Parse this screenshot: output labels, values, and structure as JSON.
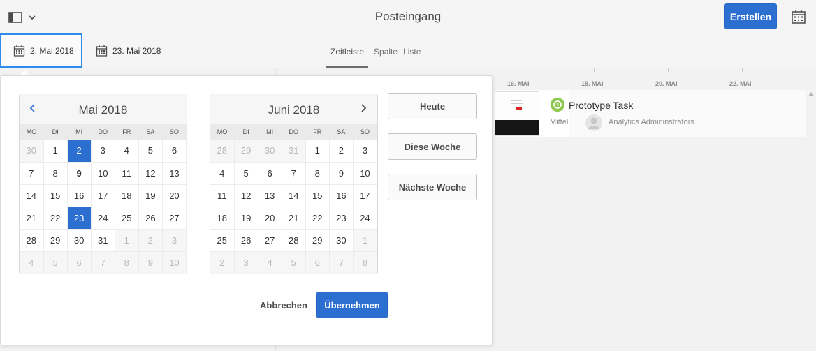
{
  "header": {
    "title": "Posteingang",
    "create_label": "Erstellen",
    "rail_icon": "rail-toggle-icon",
    "calendar_icon": "calendar-icon"
  },
  "toolbar": {
    "start_date": "2. Mai 2018",
    "end_date": "23. Mai 2018",
    "tabs": [
      {
        "label": "Zeitleiste",
        "active": true
      },
      {
        "label": "Spalte",
        "active": false
      },
      {
        "label": "Liste",
        "active": false
      }
    ]
  },
  "timeline": {
    "axis_labels": [
      "16. MAI",
      "18. MAI",
      "20. MAI",
      "22. MAI"
    ],
    "task": {
      "title": "Prototype Task",
      "priority": "Mittel",
      "assignee": "Analytics Admininstrators",
      "status_color": "#8fc851"
    }
  },
  "popover": {
    "weekdays": [
      "MO",
      "DI",
      "MI",
      "DO",
      "FR",
      "SA",
      "SO"
    ],
    "calendars": [
      {
        "title": "Mai 2018",
        "nav": "prev",
        "weeks": [
          [
            [
              "30",
              "out"
            ],
            [
              "1",
              ""
            ],
            [
              "2",
              "sel"
            ],
            [
              "3",
              ""
            ],
            [
              "4",
              ""
            ],
            [
              "5",
              ""
            ],
            [
              "6",
              ""
            ]
          ],
          [
            [
              "7",
              ""
            ],
            [
              "8",
              ""
            ],
            [
              "9",
              "today"
            ],
            [
              "10",
              ""
            ],
            [
              "11",
              ""
            ],
            [
              "12",
              ""
            ],
            [
              "13",
              ""
            ]
          ],
          [
            [
              "14",
              ""
            ],
            [
              "15",
              ""
            ],
            [
              "16",
              ""
            ],
            [
              "17",
              ""
            ],
            [
              "18",
              ""
            ],
            [
              "19",
              ""
            ],
            [
              "20",
              ""
            ]
          ],
          [
            [
              "21",
              ""
            ],
            [
              "22",
              ""
            ],
            [
              "23",
              "sel"
            ],
            [
              "24",
              ""
            ],
            [
              "25",
              ""
            ],
            [
              "26",
              ""
            ],
            [
              "27",
              ""
            ]
          ],
          [
            [
              "28",
              ""
            ],
            [
              "29",
              ""
            ],
            [
              "30",
              ""
            ],
            [
              "31",
              ""
            ],
            [
              "1",
              "out"
            ],
            [
              "2",
              "out"
            ],
            [
              "3",
              "out"
            ]
          ],
          [
            [
              "4",
              "out"
            ],
            [
              "5",
              "out"
            ],
            [
              "6",
              "out"
            ],
            [
              "7",
              "out"
            ],
            [
              "8",
              "out"
            ],
            [
              "9",
              "out"
            ],
            [
              "10",
              "out"
            ]
          ]
        ]
      },
      {
        "title": "Juni 2018",
        "nav": "next",
        "weeks": [
          [
            [
              "28",
              "out"
            ],
            [
              "29",
              "out"
            ],
            [
              "30",
              "out"
            ],
            [
              "31",
              "out"
            ],
            [
              "1",
              ""
            ],
            [
              "2",
              ""
            ],
            [
              "3",
              ""
            ]
          ],
          [
            [
              "4",
              ""
            ],
            [
              "5",
              ""
            ],
            [
              "6",
              ""
            ],
            [
              "7",
              ""
            ],
            [
              "8",
              ""
            ],
            [
              "9",
              ""
            ],
            [
              "10",
              ""
            ]
          ],
          [
            [
              "11",
              ""
            ],
            [
              "12",
              ""
            ],
            [
              "13",
              ""
            ],
            [
              "14",
              ""
            ],
            [
              "15",
              ""
            ],
            [
              "16",
              ""
            ],
            [
              "17",
              ""
            ]
          ],
          [
            [
              "18",
              ""
            ],
            [
              "19",
              ""
            ],
            [
              "20",
              ""
            ],
            [
              "21",
              ""
            ],
            [
              "22",
              ""
            ],
            [
              "23",
              ""
            ],
            [
              "24",
              ""
            ]
          ],
          [
            [
              "25",
              ""
            ],
            [
              "26",
              ""
            ],
            [
              "27",
              ""
            ],
            [
              "28",
              ""
            ],
            [
              "29",
              ""
            ],
            [
              "30",
              ""
            ],
            [
              "1",
              "out"
            ]
          ],
          [
            [
              "2",
              "out"
            ],
            [
              "3",
              "out"
            ],
            [
              "4",
              "out"
            ],
            [
              "5",
              "out"
            ],
            [
              "6",
              "out"
            ],
            [
              "7",
              "out"
            ],
            [
              "8",
              "out"
            ]
          ]
        ]
      }
    ],
    "quick_buttons": [
      "Heute",
      "Diese Woche",
      "Nächste Woche"
    ],
    "cancel_label": "Abbrechen",
    "apply_label": "Übernehmen",
    "accent_color": "#2d6ed1"
  }
}
